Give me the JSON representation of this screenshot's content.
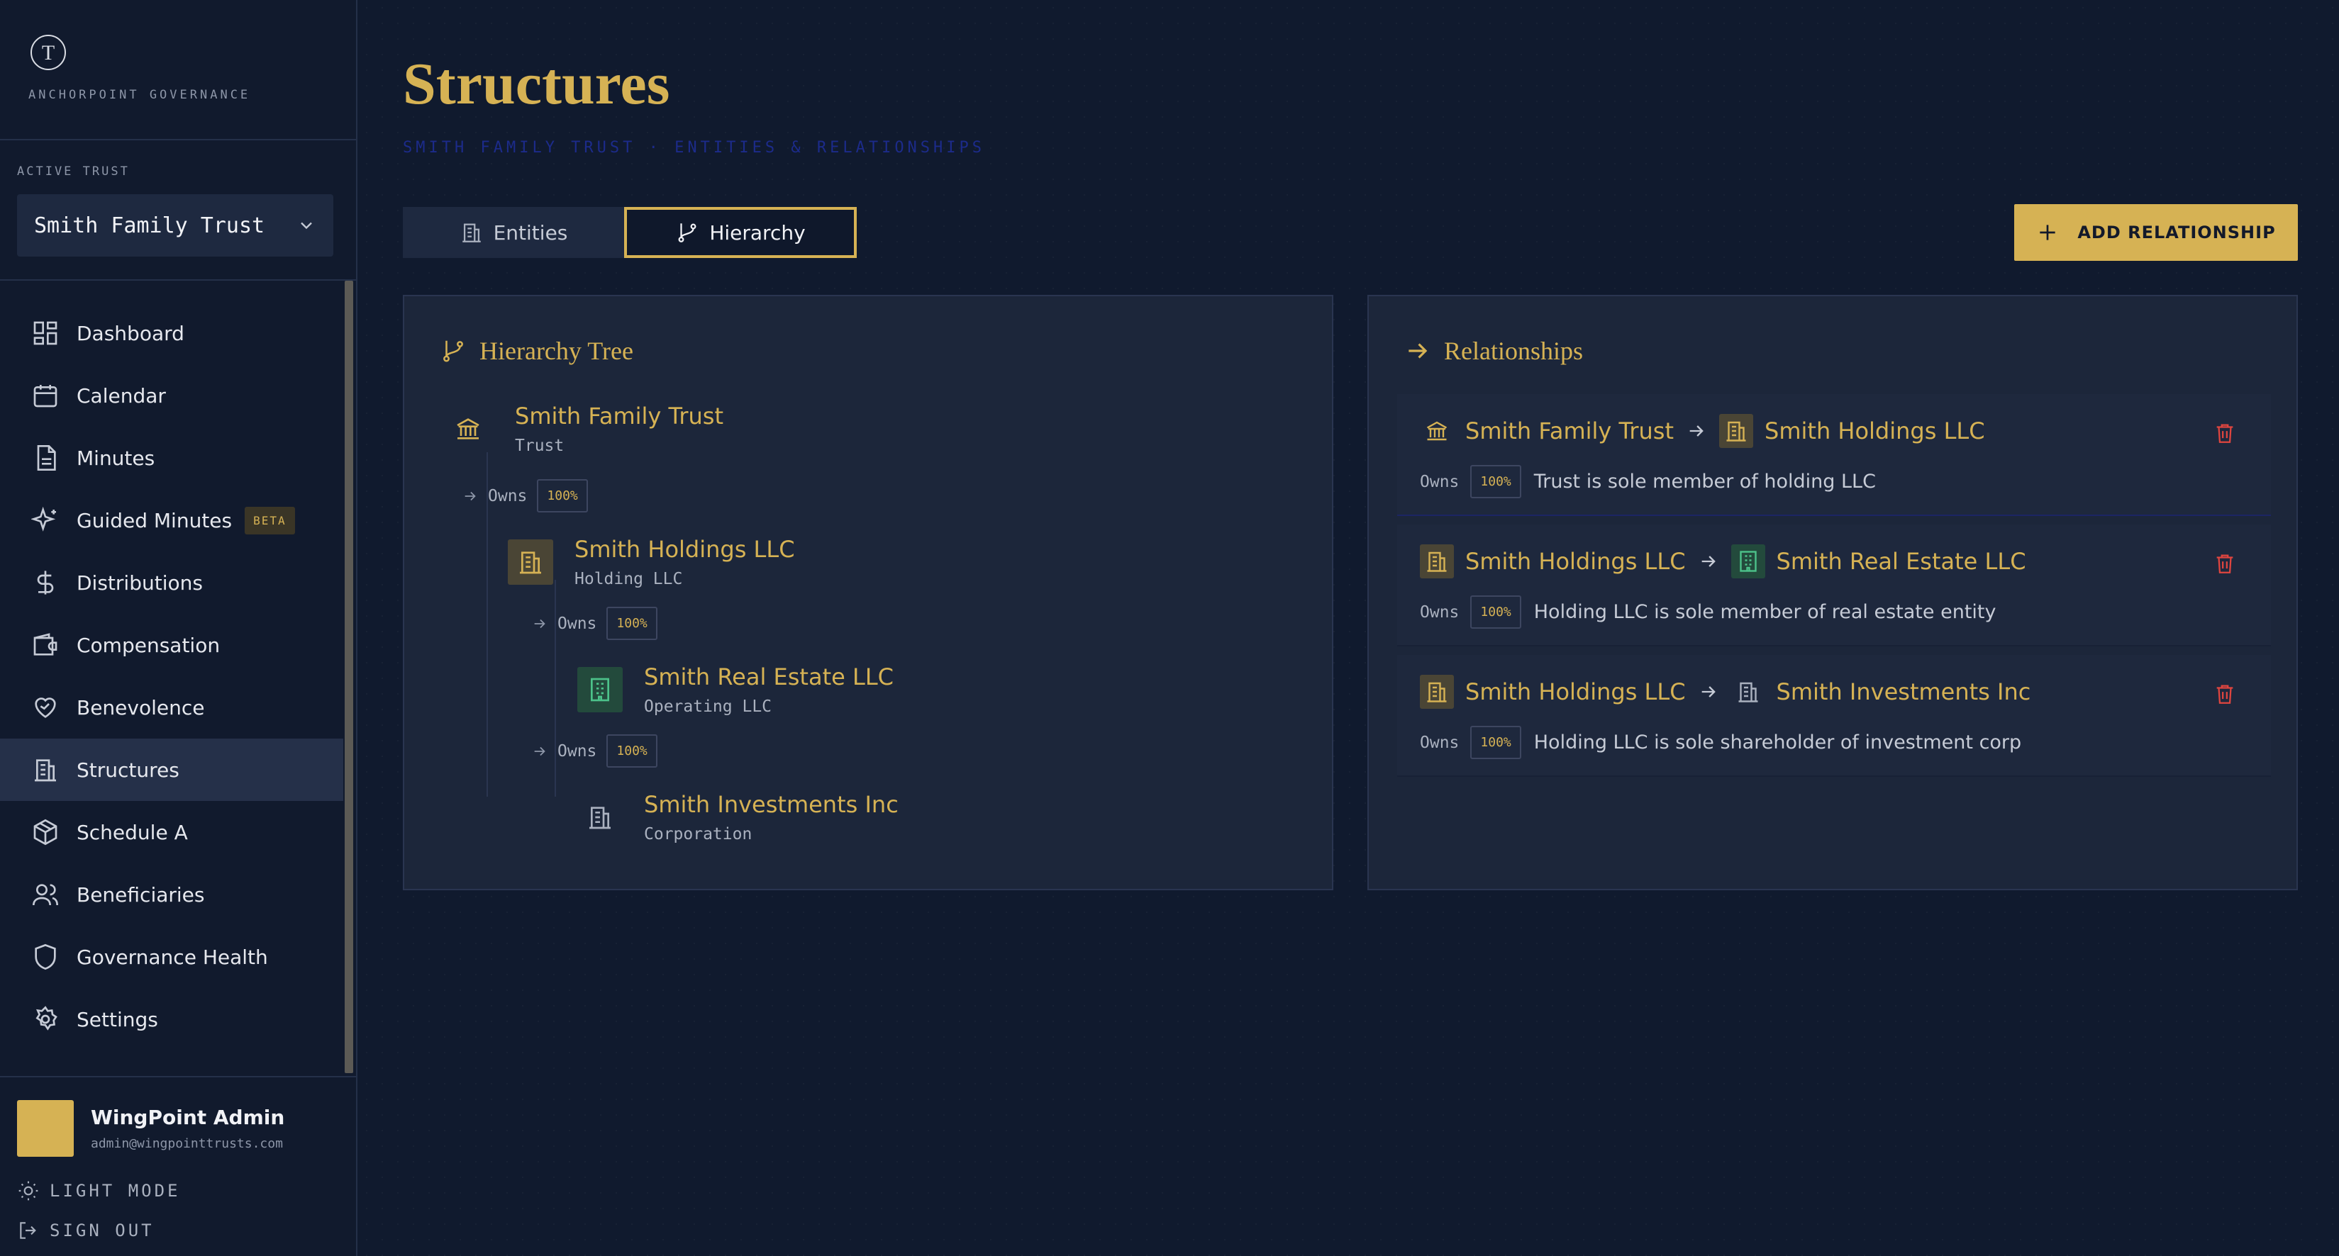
{
  "brand": {
    "name": "ANCHORPOINT GOVERNANCE",
    "logo_letter": "T"
  },
  "active_trust": {
    "label": "ACTIVE TRUST",
    "value": "Smith Family Trust"
  },
  "nav": [
    {
      "label": "Dashboard",
      "icon": "dashboard-icon"
    },
    {
      "label": "Calendar",
      "icon": "calendar-icon"
    },
    {
      "label": "Minutes",
      "icon": "document-icon"
    },
    {
      "label": "Guided Minutes",
      "icon": "sparkle-icon",
      "badge": "BETA"
    },
    {
      "label": "Distributions",
      "icon": "dollar-icon"
    },
    {
      "label": "Compensation",
      "icon": "wallet-icon"
    },
    {
      "label": "Benevolence",
      "icon": "heart-hand-icon"
    },
    {
      "label": "Structures",
      "icon": "building-icon",
      "active": true
    },
    {
      "label": "Schedule A",
      "icon": "box-icon"
    },
    {
      "label": "Beneficiaries",
      "icon": "users-icon"
    },
    {
      "label": "Governance Health",
      "icon": "shield-icon"
    },
    {
      "label": "Settings",
      "icon": "gear-icon"
    }
  ],
  "user": {
    "name": "WingPoint Admin",
    "email": "admin@wingpointtrusts.com"
  },
  "footer": {
    "light_mode": "LIGHT MODE",
    "sign_out": "SIGN OUT"
  },
  "page": {
    "title": "Structures",
    "subtitle": "SMITH FAMILY TRUST · ENTITIES & RELATIONSHIPS"
  },
  "tabs": {
    "entities": "Entities",
    "hierarchy": "Hierarchy"
  },
  "add_relationship": "ADD RELATIONSHIP",
  "hierarchy": {
    "title": "Hierarchy Tree",
    "nodes": [
      {
        "name": "Smith Family Trust",
        "type": "Trust"
      },
      {
        "name": "Smith Holdings LLC",
        "type": "Holding LLC"
      },
      {
        "name": "Smith Real Estate LLC",
        "type": "Operating LLC"
      },
      {
        "name": "Smith Investments Inc",
        "type": "Corporation"
      }
    ],
    "edges": [
      {
        "label": "Owns",
        "pct": "100%"
      },
      {
        "label": "Owns",
        "pct": "100%"
      },
      {
        "label": "Owns",
        "pct": "100%"
      }
    ]
  },
  "relationships": {
    "title": "Relationships",
    "items": [
      {
        "from": "Smith Family Trust",
        "to": "Smith Holdings LLC",
        "label": "Owns",
        "pct": "100%",
        "desc": "Trust is sole member of holding LLC"
      },
      {
        "from": "Smith Holdings LLC",
        "to": "Smith Real Estate LLC",
        "label": "Owns",
        "pct": "100%",
        "desc": "Holding LLC is sole member of real estate entity"
      },
      {
        "from": "Smith Holdings LLC",
        "to": "Smith Investments Inc",
        "label": "Owns",
        "pct": "100%",
        "desc": "Holding LLC is sole shareholder of investment corp"
      }
    ]
  },
  "colors": {
    "accent": "#d6b254",
    "background": "#101a2e",
    "panel": "#1c263a",
    "danger": "#e0453f",
    "success": "#4cc28a"
  }
}
